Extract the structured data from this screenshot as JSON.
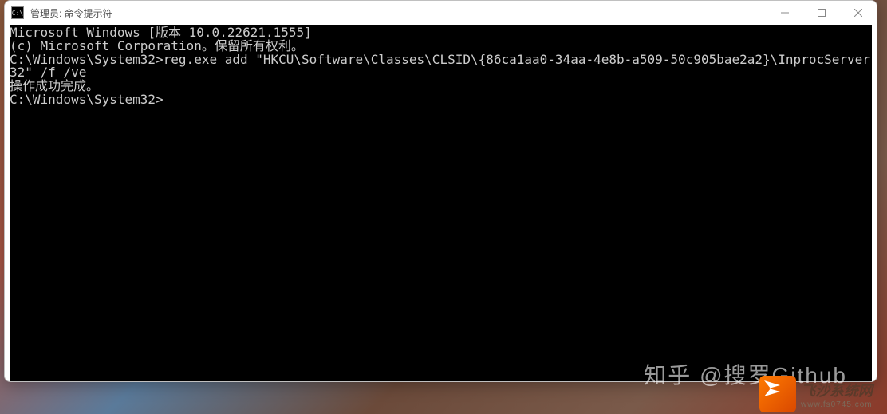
{
  "window": {
    "title": "管理员: 命令提示符",
    "icon_label": "C:\\"
  },
  "terminal": {
    "line1": "Microsoft Windows [版本 10.0.22621.1555]",
    "line2": "(c) Microsoft Corporation。保留所有权利。",
    "blank1": "",
    "line3": "C:\\Windows\\System32>reg.exe add \"HKCU\\Software\\Classes\\CLSID\\{86ca1aa0-34aa-4e8b-a509-50c905bae2a2}\\InprocServer32\" /f /ve",
    "line4": "操作成功完成。",
    "blank2": "",
    "line5": "C:\\Windows\\System32>"
  },
  "watermark": {
    "zhihu": "知乎 @搜罗Github",
    "fs_main": "飞沙系统网",
    "fs_sub": "www.fs0745.com"
  }
}
